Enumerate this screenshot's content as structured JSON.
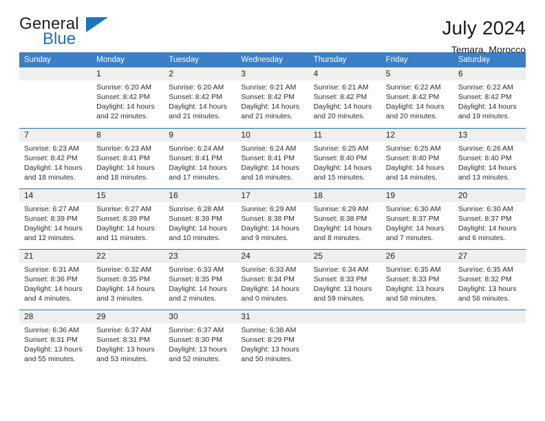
{
  "brand": {
    "name_part1": "General",
    "name_part2": "Blue"
  },
  "header": {
    "title": "July 2024",
    "subtitle": "Temara, Morocco"
  },
  "colors": {
    "header_blue": "#3b7fc4",
    "rule_blue": "#2e6da4",
    "day_band_gray": "#efefef",
    "brand_blue": "#1b75bb"
  },
  "weekdays": [
    "Sunday",
    "Monday",
    "Tuesday",
    "Wednesday",
    "Thursday",
    "Friday",
    "Saturday"
  ],
  "weeks": [
    [
      {
        "day": "",
        "sunrise": "",
        "sunset": "",
        "daylight1": "",
        "daylight2": ""
      },
      {
        "day": "1",
        "sunrise": "Sunrise: 6:20 AM",
        "sunset": "Sunset: 8:42 PM",
        "daylight1": "Daylight: 14 hours",
        "daylight2": "and 22 minutes."
      },
      {
        "day": "2",
        "sunrise": "Sunrise: 6:20 AM",
        "sunset": "Sunset: 8:42 PM",
        "daylight1": "Daylight: 14 hours",
        "daylight2": "and 21 minutes."
      },
      {
        "day": "3",
        "sunrise": "Sunrise: 6:21 AM",
        "sunset": "Sunset: 8:42 PM",
        "daylight1": "Daylight: 14 hours",
        "daylight2": "and 21 minutes."
      },
      {
        "day": "4",
        "sunrise": "Sunrise: 6:21 AM",
        "sunset": "Sunset: 8:42 PM",
        "daylight1": "Daylight: 14 hours",
        "daylight2": "and 20 minutes."
      },
      {
        "day": "5",
        "sunrise": "Sunrise: 6:22 AM",
        "sunset": "Sunset: 8:42 PM",
        "daylight1": "Daylight: 14 hours",
        "daylight2": "and 20 minutes."
      },
      {
        "day": "6",
        "sunrise": "Sunrise: 6:22 AM",
        "sunset": "Sunset: 8:42 PM",
        "daylight1": "Daylight: 14 hours",
        "daylight2": "and 19 minutes."
      }
    ],
    [
      {
        "day": "7",
        "sunrise": "Sunrise: 6:23 AM",
        "sunset": "Sunset: 8:42 PM",
        "daylight1": "Daylight: 14 hours",
        "daylight2": "and 18 minutes."
      },
      {
        "day": "8",
        "sunrise": "Sunrise: 6:23 AM",
        "sunset": "Sunset: 8:41 PM",
        "daylight1": "Daylight: 14 hours",
        "daylight2": "and 18 minutes."
      },
      {
        "day": "9",
        "sunrise": "Sunrise: 6:24 AM",
        "sunset": "Sunset: 8:41 PM",
        "daylight1": "Daylight: 14 hours",
        "daylight2": "and 17 minutes."
      },
      {
        "day": "10",
        "sunrise": "Sunrise: 6:24 AM",
        "sunset": "Sunset: 8:41 PM",
        "daylight1": "Daylight: 14 hours",
        "daylight2": "and 16 minutes."
      },
      {
        "day": "11",
        "sunrise": "Sunrise: 6:25 AM",
        "sunset": "Sunset: 8:40 PM",
        "daylight1": "Daylight: 14 hours",
        "daylight2": "and 15 minutes."
      },
      {
        "day": "12",
        "sunrise": "Sunrise: 6:25 AM",
        "sunset": "Sunset: 8:40 PM",
        "daylight1": "Daylight: 14 hours",
        "daylight2": "and 14 minutes."
      },
      {
        "day": "13",
        "sunrise": "Sunrise: 6:26 AM",
        "sunset": "Sunset: 8:40 PM",
        "daylight1": "Daylight: 14 hours",
        "daylight2": "and 13 minutes."
      }
    ],
    [
      {
        "day": "14",
        "sunrise": "Sunrise: 6:27 AM",
        "sunset": "Sunset: 8:39 PM",
        "daylight1": "Daylight: 14 hours",
        "daylight2": "and 12 minutes."
      },
      {
        "day": "15",
        "sunrise": "Sunrise: 6:27 AM",
        "sunset": "Sunset: 8:39 PM",
        "daylight1": "Daylight: 14 hours",
        "daylight2": "and 11 minutes."
      },
      {
        "day": "16",
        "sunrise": "Sunrise: 6:28 AM",
        "sunset": "Sunset: 8:39 PM",
        "daylight1": "Daylight: 14 hours",
        "daylight2": "and 10 minutes."
      },
      {
        "day": "17",
        "sunrise": "Sunrise: 6:29 AM",
        "sunset": "Sunset: 8:38 PM",
        "daylight1": "Daylight: 14 hours",
        "daylight2": "and 9 minutes."
      },
      {
        "day": "18",
        "sunrise": "Sunrise: 6:29 AM",
        "sunset": "Sunset: 8:38 PM",
        "daylight1": "Daylight: 14 hours",
        "daylight2": "and 8 minutes."
      },
      {
        "day": "19",
        "sunrise": "Sunrise: 6:30 AM",
        "sunset": "Sunset: 8:37 PM",
        "daylight1": "Daylight: 14 hours",
        "daylight2": "and 7 minutes."
      },
      {
        "day": "20",
        "sunrise": "Sunrise: 6:30 AM",
        "sunset": "Sunset: 8:37 PM",
        "daylight1": "Daylight: 14 hours",
        "daylight2": "and 6 minutes."
      }
    ],
    [
      {
        "day": "21",
        "sunrise": "Sunrise: 6:31 AM",
        "sunset": "Sunset: 8:36 PM",
        "daylight1": "Daylight: 14 hours",
        "daylight2": "and 4 minutes."
      },
      {
        "day": "22",
        "sunrise": "Sunrise: 6:32 AM",
        "sunset": "Sunset: 8:35 PM",
        "daylight1": "Daylight: 14 hours",
        "daylight2": "and 3 minutes."
      },
      {
        "day": "23",
        "sunrise": "Sunrise: 6:33 AM",
        "sunset": "Sunset: 8:35 PM",
        "daylight1": "Daylight: 14 hours",
        "daylight2": "and 2 minutes."
      },
      {
        "day": "24",
        "sunrise": "Sunrise: 6:33 AM",
        "sunset": "Sunset: 8:34 PM",
        "daylight1": "Daylight: 14 hours",
        "daylight2": "and 0 minutes."
      },
      {
        "day": "25",
        "sunrise": "Sunrise: 6:34 AM",
        "sunset": "Sunset: 8:33 PM",
        "daylight1": "Daylight: 13 hours",
        "daylight2": "and 59 minutes."
      },
      {
        "day": "26",
        "sunrise": "Sunrise: 6:35 AM",
        "sunset": "Sunset: 8:33 PM",
        "daylight1": "Daylight: 13 hours",
        "daylight2": "and 58 minutes."
      },
      {
        "day": "27",
        "sunrise": "Sunrise: 6:35 AM",
        "sunset": "Sunset: 8:32 PM",
        "daylight1": "Daylight: 13 hours",
        "daylight2": "and 56 minutes."
      }
    ],
    [
      {
        "day": "28",
        "sunrise": "Sunrise: 6:36 AM",
        "sunset": "Sunset: 8:31 PM",
        "daylight1": "Daylight: 13 hours",
        "daylight2": "and 55 minutes."
      },
      {
        "day": "29",
        "sunrise": "Sunrise: 6:37 AM",
        "sunset": "Sunset: 8:31 PM",
        "daylight1": "Daylight: 13 hours",
        "daylight2": "and 53 minutes."
      },
      {
        "day": "30",
        "sunrise": "Sunrise: 6:37 AM",
        "sunset": "Sunset: 8:30 PM",
        "daylight1": "Daylight: 13 hours",
        "daylight2": "and 52 minutes."
      },
      {
        "day": "31",
        "sunrise": "Sunrise: 6:38 AM",
        "sunset": "Sunset: 8:29 PM",
        "daylight1": "Daylight: 13 hours",
        "daylight2": "and 50 minutes."
      },
      {
        "day": "",
        "sunrise": "",
        "sunset": "",
        "daylight1": "",
        "daylight2": ""
      },
      {
        "day": "",
        "sunrise": "",
        "sunset": "",
        "daylight1": "",
        "daylight2": ""
      },
      {
        "day": "",
        "sunrise": "",
        "sunset": "",
        "daylight1": "",
        "daylight2": ""
      }
    ]
  ]
}
